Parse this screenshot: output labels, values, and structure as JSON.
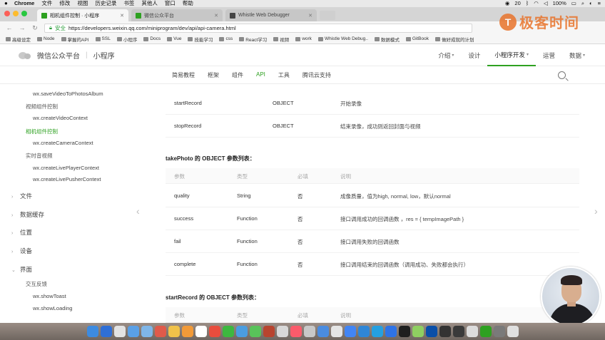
{
  "menubar": {
    "apple": "",
    "items": [
      "Chrome",
      "文件",
      "修改",
      "视图",
      "历史记录",
      "书签",
      "其他人",
      "窗口",
      "帮助"
    ],
    "right_items": [
      "20",
      "100%",
      ""
    ]
  },
  "browser": {
    "tabs": [
      {
        "label": "相机组件控制 · 小程序",
        "color": "#2ea121",
        "active": true
      },
      {
        "label": "微信公众平台",
        "color": "#2ea121",
        "active": false
      },
      {
        "label": "Whistle Web Debugger",
        "color": "#444444",
        "active": false
      }
    ],
    "omnibox": {
      "security": "安全",
      "url": "https://developers.weixin.qq.com/miniprogram/dev/api/api-camera.html"
    },
    "bookmarks": [
      "高级设定",
      "Node",
      "掌握的API",
      "SSL",
      "小程序",
      "Docs",
      "Vue",
      "技能学习",
      "css",
      "React学习",
      "视频",
      "work",
      "Whistle Web Debug..",
      "数据模式",
      "GitBook",
      "做好成就的计划"
    ]
  },
  "watermark": {
    "symbol": "T",
    "text": "极客时间"
  },
  "site": {
    "brand": "微信公众平台",
    "section": "小程序",
    "nav": [
      {
        "label": "介绍",
        "caret": true,
        "active": false
      },
      {
        "label": "设计",
        "caret": false,
        "active": false
      },
      {
        "label": "小程序开发",
        "caret": true,
        "active": true
      },
      {
        "label": "运营",
        "caret": false,
        "active": false
      },
      {
        "label": "数据",
        "caret": true,
        "active": false
      }
    ],
    "subnav": [
      {
        "label": "简易教程",
        "active": false
      },
      {
        "label": "框架",
        "active": false
      },
      {
        "label": "组件",
        "active": false
      },
      {
        "label": "API",
        "active": true
      },
      {
        "label": "工具",
        "active": false
      },
      {
        "label": "腾讯云支持",
        "active": false
      }
    ]
  },
  "sidebar": {
    "items": [
      {
        "label": "wx.saveVideoToPhotosAlbum",
        "kind": "api"
      },
      {
        "label": "视频组件控制",
        "kind": "group"
      },
      {
        "label": "wx.createVideoContext",
        "kind": "api"
      },
      {
        "label": "相机组件控制",
        "kind": "group-active"
      },
      {
        "label": "wx.createCameraContext",
        "kind": "api"
      },
      {
        "label": "实时音视频",
        "kind": "group"
      },
      {
        "label": "wx.createLivePlayerContext",
        "kind": "api"
      },
      {
        "label": "wx.createLivePusherContext",
        "kind": "api"
      },
      {
        "label": "文件",
        "kind": "section",
        "arrow": "›"
      },
      {
        "label": "数据缓存",
        "kind": "section",
        "arrow": "›"
      },
      {
        "label": "位置",
        "kind": "section",
        "arrow": "›"
      },
      {
        "label": "设备",
        "kind": "section",
        "arrow": "›"
      },
      {
        "label": "界面",
        "kind": "section",
        "arrow": "⌄"
      },
      {
        "label": "交互反馈",
        "kind": "group"
      },
      {
        "label": "wx.showToast",
        "kind": "api"
      },
      {
        "label": "wx.showLoading",
        "kind": "api"
      }
    ]
  },
  "content": {
    "top_rows": [
      {
        "name": "startRecord",
        "type": "OBJECT",
        "desc": "开始录像"
      },
      {
        "name": "stopRecord",
        "type": "OBJECT",
        "desc": "结束录像，成功则返回封面与视频"
      }
    ],
    "takePhoto": {
      "title": "takePhoto 的 OBJECT 参数列表：",
      "headers": [
        "参数",
        "类型",
        "必填",
        "说明"
      ],
      "rows": [
        {
          "param": "quality",
          "type": "String",
          "required": "否",
          "desc": "成像质量，值为high, normal, low，默认normal"
        },
        {
          "param": "success",
          "type": "Function",
          "required": "否",
          "desc": "接口调用成功的回调函数 ，res = { tempImagePath }"
        },
        {
          "param": "fail",
          "type": "Function",
          "required": "否",
          "desc": "接口调用失败的回调函数"
        },
        {
          "param": "complete",
          "type": "Function",
          "required": "否",
          "desc": "接口调用结束的回调函数（调用成功、失败都会执行）"
        }
      ]
    },
    "startRecord": {
      "title": "startRecord 的 OBJECT 参数列表：",
      "headers": [
        "参数",
        "类型",
        "必填",
        "说明"
      ]
    },
    "prev_arrow": "‹",
    "next_arrow": "›"
  },
  "dock": {
    "app_colors": [
      "#3d8be0",
      "#2f6fd6",
      "#e3e3e3",
      "#5aa0e6",
      "#7fb6e8",
      "#e05a4a",
      "#f0c24a",
      "#f29a38",
      "#ffffff",
      "#e84d3d",
      "#3db83f",
      "#4b9de0",
      "#59c35a",
      "#b8442f",
      "#d8d8d8",
      "#fb5b6b",
      "#c8c8c8",
      "#4a8ce0",
      "#e5e5e5",
      "#4285f4",
      "#2f86d6",
      "#25a0e0",
      "#2f73e6",
      "#1f1f1f",
      "#8fcf61",
      "#0a4fa8",
      "#333333",
      "#3a3a3a",
      "#dcdcdc",
      "#2ea121",
      "#7a7a7a",
      "#e0e0e0"
    ]
  }
}
